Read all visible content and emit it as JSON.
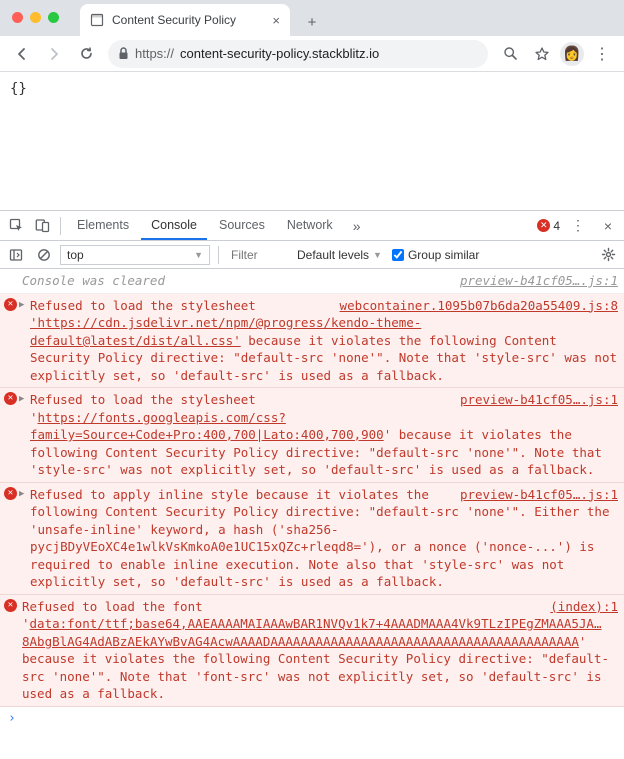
{
  "browser": {
    "tab_title": "Content Security Policy",
    "url_protocol": "https://",
    "url_host": "content-security-policy.stackblitz.io",
    "avatar_glyph": "👩",
    "new_tab_label": "+",
    "close_tab_label": "×"
  },
  "page": {
    "body_text": "{}"
  },
  "devtools": {
    "tabs": [
      "Elements",
      "Console",
      "Sources",
      "Network"
    ],
    "active_tab": "Console",
    "overflow_glyph": "»",
    "error_count": "4",
    "menu_glyph": "⋮",
    "close_glyph": "×"
  },
  "cfilter": {
    "context": "top",
    "filter_placeholder": "Filter",
    "levels_label": "Default levels",
    "group_label": "Group similar"
  },
  "console": {
    "cleared": {
      "text": "Console was cleared",
      "source": "preview-b41cf05….js:1"
    },
    "rows": [
      {
        "tri": true,
        "source": "webcontainer.1095b07b6da20a55409.js:8",
        "pre": "Refused to load the stylesheet ",
        "link": "'https://cdn.jsdelivr.net/npm/@progress/kendo-theme-default@latest/dist/all.css'",
        "post": " because it violates the following Content Security Policy directive: \"default-src 'none'\". Note that 'style-src' was not explicitly set, so 'default-src' is used as a fallback."
      },
      {
        "tri": true,
        "source": "preview-b41cf05….js:1",
        "pre": "Refused to load the stylesheet '",
        "link": "https://fonts.googleapis.com/css?family=Source+Code+Pro:400,700|Lato:400,700,900",
        "post": "' because it violates the following Content Security Policy directive: \"default-src 'none'\". Note that 'style-src' was not explicitly set, so 'default-src' is used as a fallback."
      },
      {
        "tri": true,
        "source": "preview-b41cf05….js:1",
        "pre": "",
        "link": "",
        "post": "Refused to apply inline style because it violates the following Content Security Policy directive: \"default-src 'none'\". Either the 'unsafe-inline' keyword, a hash ('sha256-pycjBDyVEoXC4e1wlkVsKmkoA0e1UC15xQZc+rleqd8='), or a nonce ('nonce-...') is required to enable inline execution. Note also that 'style-src' was not explicitly set, so 'default-src' is used as a fallback."
      },
      {
        "tri": false,
        "source": "(index):1",
        "pre": "Refused to load the font '",
        "link": "data:font/ttf;base64,AAEAAAAMAIAAAwBAR1NVQv1k7+4AAADMAAA4Vk9TLzIPEgZMAAA5JA…8AbgBlAG4AdABzAEkAYwBvAG4AcwAAAADAAAAAAAAAAAAAAAAAAAAAAAAAAAAAAAAAAAAAAAAA",
        "post": "' because it violates the following Content Security Policy directive: \"default-src 'none'\". Note that 'font-src' was not explicitly set, so 'default-src' is used as a fallback."
      }
    ],
    "prompt_glyph": "›"
  },
  "colors": {
    "error_bg": "#fdf0ef",
    "error_fg": "#c0392b",
    "tab_active": "#1a73e8"
  }
}
